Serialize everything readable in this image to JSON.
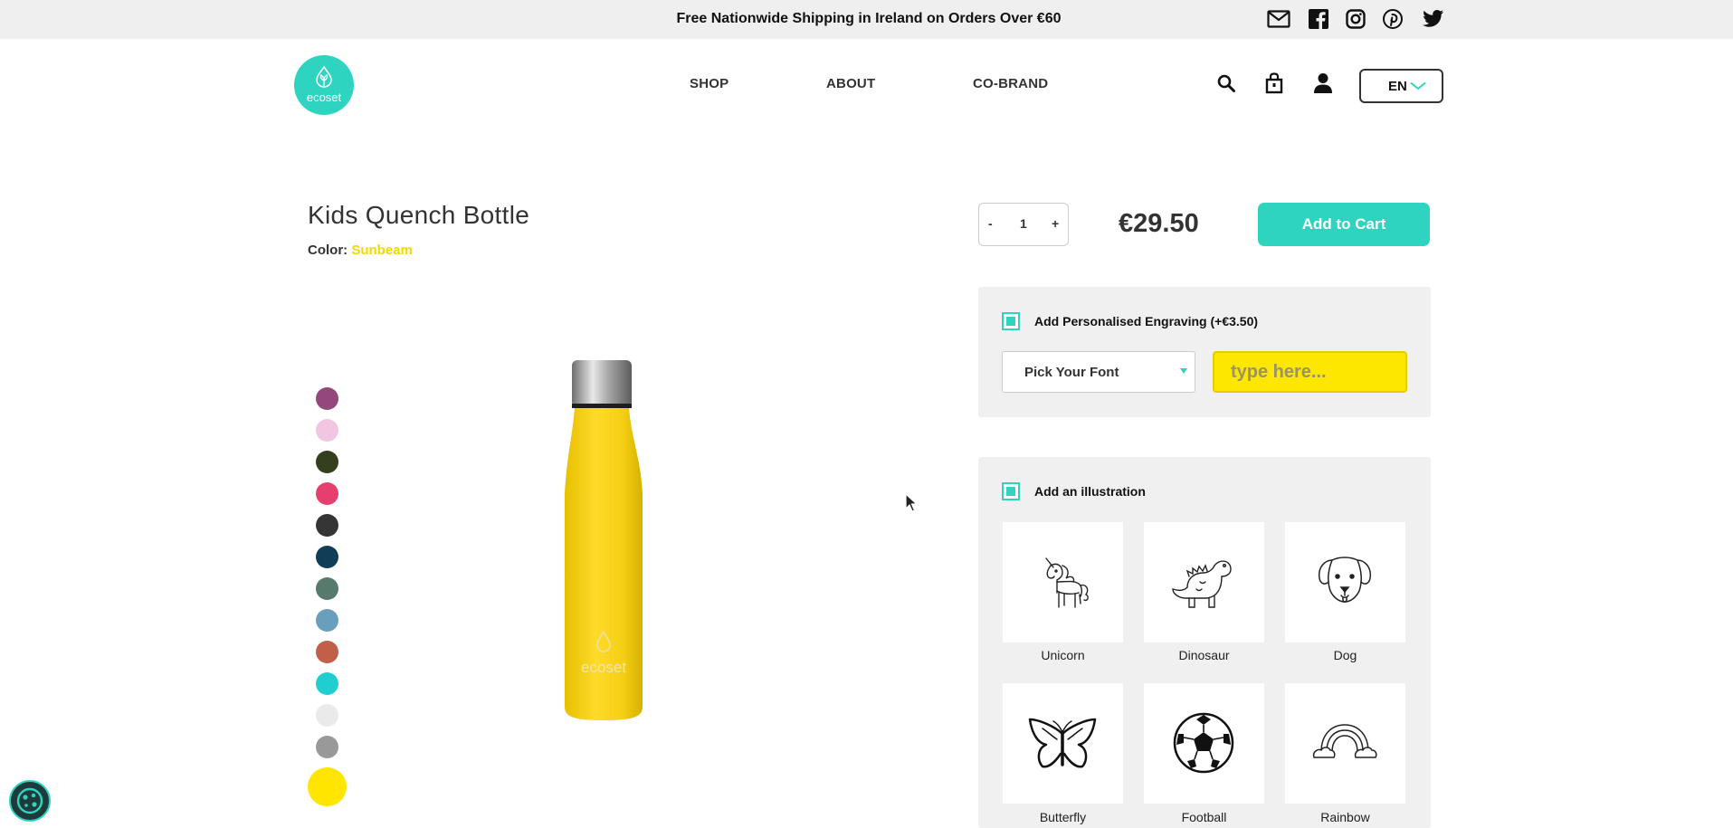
{
  "announcement": "Free Nationwide Shipping in Ireland on Orders Over €60",
  "social_icons": [
    "mail-icon",
    "facebook-icon",
    "instagram-icon",
    "pinterest-icon",
    "twitter-icon"
  ],
  "brand": {
    "logo_text": "ecoset",
    "accent": "#2fd4c0"
  },
  "nav": {
    "shop": "SHOP",
    "about": "ABOUT",
    "cobrand": "CO-BRAND"
  },
  "header_icons": [
    "search-icon",
    "bag-icon",
    "user-icon"
  ],
  "language": "EN",
  "product": {
    "title": "Kids Quench Bottle",
    "color_label": "Color:",
    "color_name": "Sunbeam",
    "bottle_logo": "ecoset",
    "swatches": [
      "#93477a",
      "#f2c6e0",
      "#343f1e",
      "#e63f6e",
      "#353535",
      "#123d56",
      "#577a6d",
      "#689fba",
      "#c15f49",
      "#1fcfd0",
      "#eaeaea",
      "#999999",
      "#ffe500"
    ],
    "selected_swatch_color": "#ffe500"
  },
  "purchase": {
    "qty_minus": "-",
    "qty_value": "1",
    "qty_plus": "+",
    "price": "€29.50",
    "add_to_cart": "Add to Cart"
  },
  "engraving": {
    "label": "Add Personalised Engraving (+€3.50)",
    "font_select": "Pick Your Font",
    "text_placeholder": "type here..."
  },
  "illustrations": {
    "label": "Add an illustration",
    "items": [
      {
        "label": "Unicorn",
        "icon": "unicorn-icon"
      },
      {
        "label": "Dinosaur",
        "icon": "dinosaur-icon"
      },
      {
        "label": "Dog",
        "icon": "dog-icon"
      },
      {
        "label": "Butterfly",
        "icon": "butterfly-icon"
      },
      {
        "label": "Football",
        "icon": "football-icon"
      },
      {
        "label": "Rainbow",
        "icon": "rainbow-icon"
      }
    ]
  }
}
